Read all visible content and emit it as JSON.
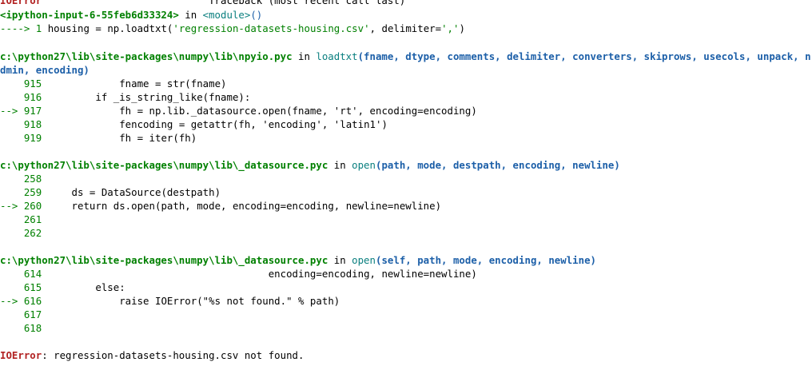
{
  "header": {
    "error_name": "IOError",
    "traceback_label": "Traceback (most recent call last)"
  },
  "frame0": {
    "source": "<ipython-input-6-55feb6d33324>",
    "in": " in ",
    "func": "<module>",
    "parens": "()",
    "arrow": "---->",
    "lineno": "1",
    "code_pre": "housing = np.loadtxt(",
    "code_str": "'regression-datasets-housing.csv'",
    "code_mid": ", delimiter=",
    "code_str2": "','",
    "code_post": ")"
  },
  "frame1": {
    "path": "c:\\python27\\lib\\site-packages\\numpy\\lib\\npyio.pyc",
    "in": " in ",
    "func": "loadtxt",
    "args_line1": "(fname, dtype, comments, delimiter, converters, skiprows, usecols, unpack, n",
    "args_line2": "dmin, encoding)",
    "lines": [
      {
        "marker": "    ",
        "no": "915",
        "code": "            fname = str(fname)"
      },
      {
        "marker": "    ",
        "no": "916",
        "code": "        if _is_string_like(fname):"
      },
      {
        "marker": "--> ",
        "no": "917",
        "code": "            fh = np.lib._datasource.open(fname, 'rt', encoding=encoding)"
      },
      {
        "marker": "    ",
        "no": "918",
        "code": "            fencoding = getattr(fh, 'encoding', 'latin1')"
      },
      {
        "marker": "    ",
        "no": "919",
        "code": "            fh = iter(fh)"
      }
    ]
  },
  "frame2": {
    "path": "c:\\python27\\lib\\site-packages\\numpy\\lib\\_datasource.pyc",
    "in": " in ",
    "func": "open",
    "args": "(path, mode, destpath, encoding, newline)",
    "lines": [
      {
        "marker": "    ",
        "no": "258",
        "code": ""
      },
      {
        "marker": "    ",
        "no": "259",
        "code": "    ds = DataSource(destpath)"
      },
      {
        "marker": "--> ",
        "no": "260",
        "code": "    return ds.open(path, mode, encoding=encoding, newline=newline)"
      },
      {
        "marker": "    ",
        "no": "261",
        "code": ""
      },
      {
        "marker": "    ",
        "no": "262",
        "code": ""
      }
    ]
  },
  "frame3": {
    "path": "c:\\python27\\lib\\site-packages\\numpy\\lib\\_datasource.pyc",
    "in": " in ",
    "func": "open",
    "args": "(self, path, mode, encoding, newline)",
    "lines": [
      {
        "marker": "    ",
        "no": "614",
        "code": "                                     encoding=encoding, newline=newline)"
      },
      {
        "marker": "    ",
        "no": "615",
        "code": "        else:"
      },
      {
        "marker": "--> ",
        "no": "616",
        "code": "            raise IOError(\"%s not found.\" % path)"
      },
      {
        "marker": "    ",
        "no": "617",
        "code": ""
      },
      {
        "marker": "    ",
        "no": "618",
        "code": ""
      }
    ]
  },
  "footer": {
    "error_name": "IOError",
    "message": ": regression-datasets-housing.csv not found."
  },
  "colors": {
    "error": "#b22222",
    "lineno": "#008000",
    "func": "#1c5fa8"
  }
}
